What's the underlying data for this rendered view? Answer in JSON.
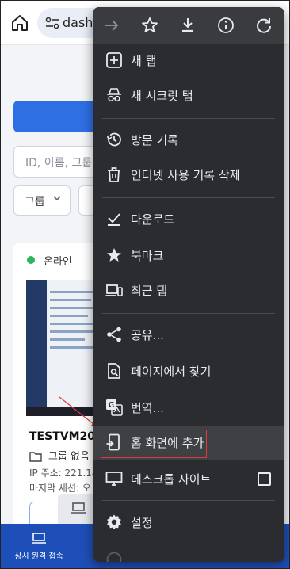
{
  "url": {
    "text": "dash."
  },
  "page": {
    "search_placeholder": "ID, 이름, 그룹,",
    "group_filter": "그룹",
    "status": "온라인",
    "device": {
      "name": "TESTVM209",
      "group": "그룹 없음",
      "ip": "IP 주소: 221.14",
      "last_session": "마지막 세션: 오"
    },
    "bottom_nav": {
      "label": "상시 원격 접속"
    }
  },
  "menu": {
    "top_icons": [
      "forward-arrow-icon",
      "star-icon",
      "download-icon",
      "info-icon",
      "reload-icon"
    ],
    "items": [
      {
        "label": "새 탭",
        "icon": "plus-box-icon"
      },
      {
        "label": "새 시크릿 탭",
        "icon": "incognito-icon"
      },
      {
        "label": "방문 기록",
        "icon": "history-icon"
      },
      {
        "label": "인터넷 사용 기록 삭제",
        "icon": "trash-icon"
      },
      {
        "label": "다운로드",
        "icon": "download-check-icon"
      },
      {
        "label": "북마크",
        "icon": "star-filled-icon"
      },
      {
        "label": "최근 탭",
        "icon": "devices-icon"
      },
      {
        "label": "공유...",
        "icon": "share-icon"
      },
      {
        "label": "페이지에서 찾기",
        "icon": "find-in-page-icon"
      },
      {
        "label": "번역...",
        "icon": "translate-icon"
      },
      {
        "label": "홈 화면에 추가",
        "icon": "add-to-home-icon"
      },
      {
        "label": "데스크톱 사이트",
        "icon": "desktop-icon"
      },
      {
        "label": "설정",
        "icon": "gear-icon"
      }
    ]
  },
  "colors": {
    "menu_bg": "#2b2c2f",
    "highlight_border": "#e23b3b",
    "bottom_bar": "#1e4fb8",
    "online": "#2db55d"
  }
}
